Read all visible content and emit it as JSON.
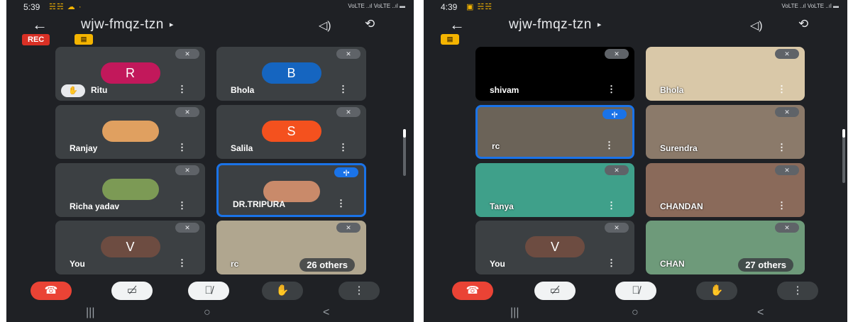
{
  "left": {
    "status": {
      "time": "5:39",
      "icons": "☵☵ ☁ ·",
      "signal": "VoLTE ..ıl VoLTE ..ıl ▬"
    },
    "meeting_code": "wjw-fmqz-tzn",
    "rec_label": "REC",
    "tiles": [
      {
        "name": "Ritu",
        "initial": "R",
        "color": "#c2185b",
        "hand": true
      },
      {
        "name": "Bhola",
        "initial": "B",
        "color": "#1565c0"
      },
      {
        "name": "Ranjay",
        "photo": true,
        "color": "#e0a060"
      },
      {
        "name": "Salila",
        "initial": "S",
        "color": "#f4511e"
      },
      {
        "name": "Richa yadav",
        "photo": true,
        "color": "#7c9a55"
      },
      {
        "name": "DR.TRIPURA",
        "photo": true,
        "color": "#c98a6a",
        "speaking": true
      },
      {
        "name": "You",
        "initial": "V",
        "color": "#6d4c41"
      },
      {
        "name": "rc",
        "video": true,
        "color": "#b0a68f",
        "others": "26 others"
      }
    ]
  },
  "right": {
    "status": {
      "time": "4:39",
      "icons": "▣ ☵☵",
      "signal": "VoLTE ..ıl VoLTE ..ıl ▬"
    },
    "meeting_code": "wjw-fmqz-tzn",
    "tiles": [
      {
        "name": "shivam",
        "color": "#000000"
      },
      {
        "name": "Bhola",
        "video": true,
        "color": "#d9c8a8"
      },
      {
        "name": "rc",
        "video": true,
        "color": "#6b6358",
        "speaking": true
      },
      {
        "name": "Surendra",
        "video": true,
        "color": "#8b7a6a"
      },
      {
        "name": "Tanya",
        "video": true,
        "color": "#3fa08a"
      },
      {
        "name": "CHANDAN",
        "video": true,
        "color": "#8a6a5a"
      },
      {
        "name": "You",
        "initial": "V",
        "color": "#6d4c41"
      },
      {
        "name": "CHAN",
        "video": true,
        "color": "#6e9a7a",
        "others": "27 others"
      }
    ]
  },
  "icons": {
    "back": "←",
    "caret": "▸",
    "audio": "◁)",
    "camera": "⟲",
    "mute": "🎙̸",
    "more": "⋮",
    "hand": "✋",
    "end_call": "☎",
    "cam_off": "▭̸",
    "mic_off": "🎙̸",
    "nav_recent": "|||",
    "nav_home": "○",
    "nav_back": "<"
  }
}
